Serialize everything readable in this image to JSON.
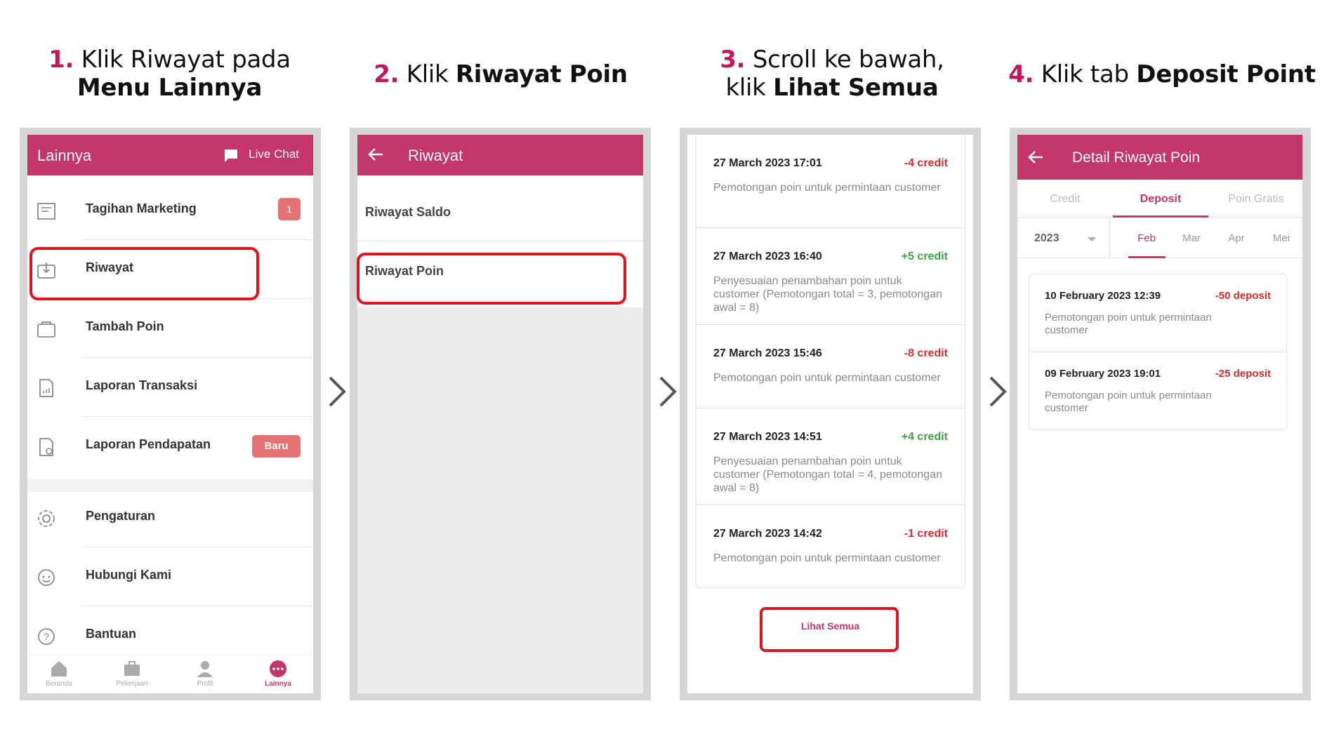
{
  "steps": [
    {
      "num": "1.",
      "line1": "Klik Riwayat pada",
      "line2_bold": "Menu Lainnya"
    },
    {
      "num": "2.",
      "plain": "Klik ",
      "bold": "Riwayat Poin"
    },
    {
      "num": "3.",
      "line1": "Scroll ke bawah,",
      "line2_plain": "klik ",
      "line2_bold": "Lihat Semua"
    },
    {
      "num": "4.",
      "plain": "Klik tab ",
      "bold": "Deposit Point"
    }
  ],
  "screen1": {
    "title": "Lainnya",
    "live_chat": "Live Chat",
    "items": [
      {
        "label": "Tagihan Marketing",
        "badge": "1"
      },
      {
        "label": "Riwayat"
      },
      {
        "label": "Tambah Poin"
      },
      {
        "label": "Laporan Transaksi"
      },
      {
        "label": "Laporan Pendapatan",
        "badge": "Baru"
      },
      {
        "label": "Pengaturan"
      },
      {
        "label": "Hubungi Kami"
      },
      {
        "label": "Bantuan"
      }
    ],
    "nav": [
      "Beranda",
      "Pekerjaan",
      "Profil",
      "Lainnya"
    ]
  },
  "screen2": {
    "title": "Riwayat",
    "items": [
      "Riwayat Saldo",
      "Riwayat Poin"
    ]
  },
  "screen3": {
    "transactions": [
      {
        "date": "27 March 2023 17:01",
        "amount": "-4 credit",
        "desc": "Pemotongan poin untuk permintaan customer"
      },
      {
        "date": "27 March 2023 16:40",
        "amount": "+5 credit",
        "desc": "Penyesuaian penambahan poin untuk customer                    (Pemotongan total = 3, pemotongan awal = 8)"
      },
      {
        "date": "27 March 2023 15:46",
        "amount": "-8 credit",
        "desc": "Pemotongan poin untuk permintaan customer"
      },
      {
        "date": "27 March 2023 14:51",
        "amount": "+4 credit",
        "desc": "Penyesuaian penambahan poin untuk customer                    (Pemotongan total = 4, pemotongan awal = 8)"
      },
      {
        "date": "27 March 2023 14:42",
        "amount": "-1 credit",
        "desc": "Pemotongan poin untuk permintaan customer"
      }
    ],
    "see_all": "Lihat Semua"
  },
  "screen4": {
    "title": "Detail Riwayat Poin",
    "tabs": [
      "Credit",
      "Deposit",
      "Poin Gratis"
    ],
    "year": "2023",
    "months": [
      "Feb",
      "Mar",
      "Apr",
      "Mei"
    ],
    "deposits": [
      {
        "date": "10 February 2023 12:39",
        "amount": "-50 deposit",
        "desc": "Pemotongan poin untuk permintaan customer"
      },
      {
        "date": "09 February 2023 19:01",
        "amount": "-25 deposit",
        "desc": "Pemotongan poin untuk permintaan customer"
      }
    ]
  },
  "colors": {
    "brand": "#c2366a",
    "step_number": "#c2185b",
    "highlight": "#e0141e",
    "negative": "#d32f2f",
    "positive": "#43a047"
  }
}
